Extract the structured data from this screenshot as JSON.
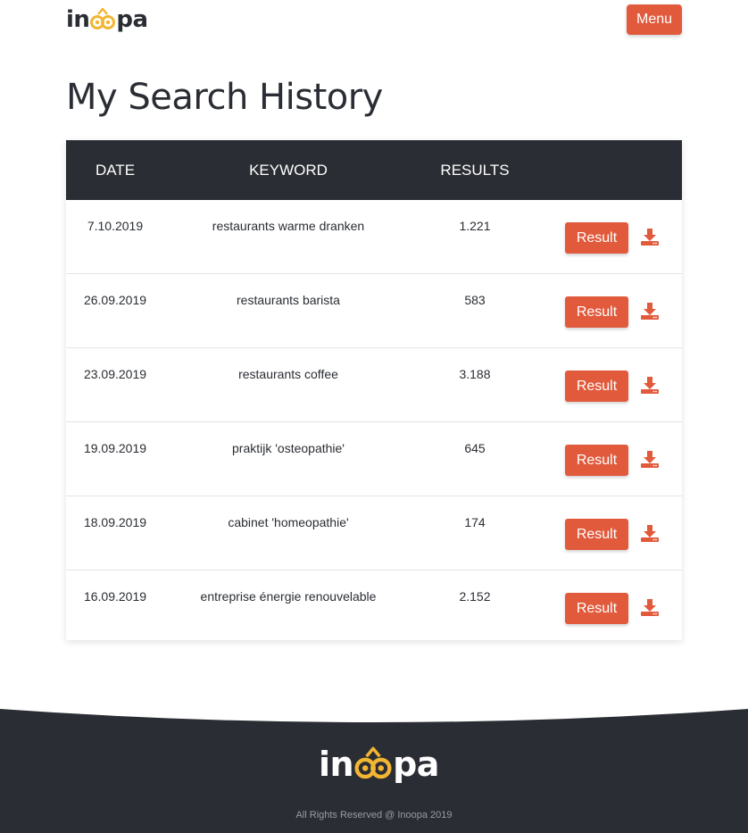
{
  "brand": {
    "logo_text": "inoopa",
    "accent": "#e15a3c",
    "owl_color": "#f2b632",
    "dark": "#2a2d33"
  },
  "header": {
    "menu_label": "Menu"
  },
  "page": {
    "title": "My Search History"
  },
  "table": {
    "headers": {
      "date": "DATE",
      "keyword": "KEYWORD",
      "results": "RESULTS"
    },
    "result_button_label": "Result",
    "download_icon": "download-icon",
    "rows": [
      {
        "date": "7.10.2019",
        "keyword": "restaurants warme dranken",
        "results": "1.221"
      },
      {
        "date": "26.09.2019",
        "keyword": "restaurants barista",
        "results": "583"
      },
      {
        "date": "23.09.2019",
        "keyword": "restaurants coffee",
        "results": "3.188"
      },
      {
        "date": "19.09.2019",
        "keyword": "praktijk 'osteopathie'",
        "results": "645"
      },
      {
        "date": "18.09.2019",
        "keyword": "cabinet 'homeopathie'",
        "results": "174"
      },
      {
        "date": "16.09.2019",
        "keyword": "entreprise énergie renouvelable",
        "results": "2.152"
      }
    ]
  },
  "footer": {
    "copyright": "All Rights Reserved @ Inoopa 2019"
  }
}
